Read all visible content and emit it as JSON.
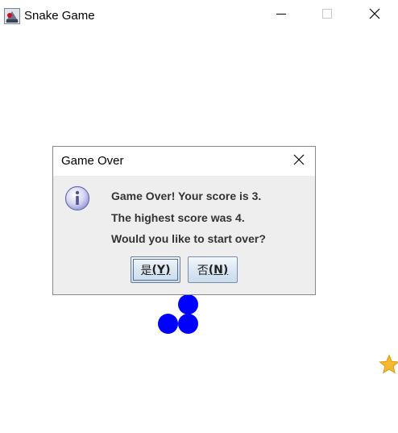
{
  "window": {
    "title": "Snake Game",
    "controls": [
      "minimize-icon",
      "maximize-icon",
      "close-icon"
    ]
  },
  "board": {
    "snake_color": "#0000ff",
    "food_icon": "star-icon",
    "food_color": "#f5b82e"
  },
  "dialog": {
    "title": "Game Over",
    "icon": "info-icon",
    "lines": [
      "Game Over! Your score is 3.",
      "The highest score was 4.",
      "Would you like to start over?"
    ],
    "yes_label": "是",
    "yes_mnemonic": "(Y)",
    "no_label": "否",
    "no_mnemonic": "(N)"
  }
}
